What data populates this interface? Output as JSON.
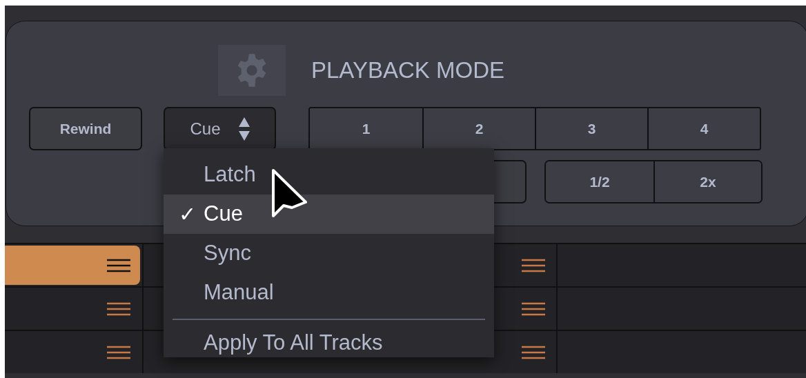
{
  "panel": {
    "title": "PLAYBACK MODE"
  },
  "rewind_button": {
    "label": "Rewind"
  },
  "mode_select": {
    "value": "Cue"
  },
  "track_buttons": [
    {
      "label": "1"
    },
    {
      "label": "2"
    },
    {
      "label": "3"
    },
    {
      "label": "4"
    }
  ],
  "speed_buttons": [
    {
      "label": "1/2"
    },
    {
      "label": "2x"
    }
  ],
  "mode_menu": {
    "items": [
      {
        "label": "Latch",
        "checked": false,
        "highlighted": false
      },
      {
        "label": "Cue",
        "checked": true,
        "highlighted": true
      },
      {
        "label": "Sync",
        "checked": false,
        "highlighted": false
      },
      {
        "label": "Manual",
        "checked": false,
        "highlighted": false
      }
    ],
    "check_mark": "✓",
    "footer_item": "Apply To All Tracks"
  },
  "tracks": [
    {
      "selected": true
    },
    {
      "selected": false
    },
    {
      "selected": false
    }
  ]
}
